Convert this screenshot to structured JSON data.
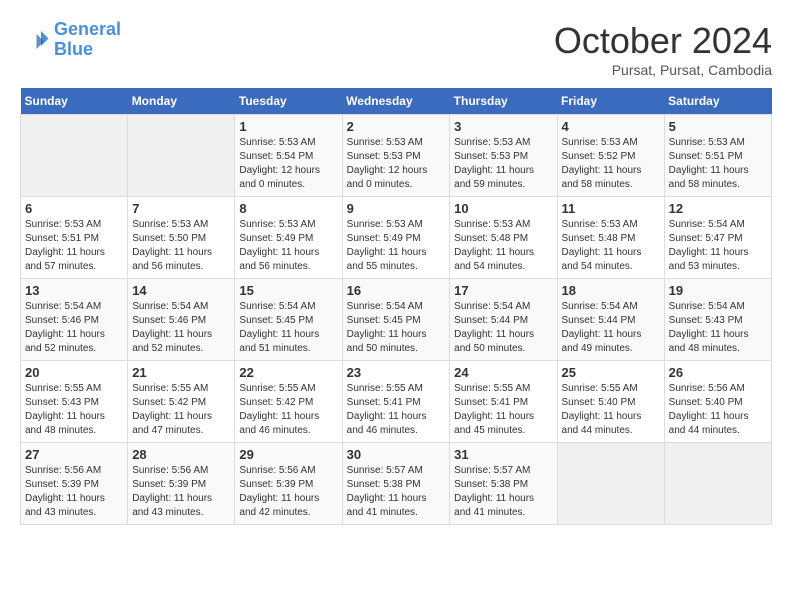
{
  "logo": {
    "line1": "General",
    "line2": "Blue"
  },
  "title": "October 2024",
  "subtitle": "Pursat, Pursat, Cambodia",
  "days_of_week": [
    "Sunday",
    "Monday",
    "Tuesday",
    "Wednesday",
    "Thursday",
    "Friday",
    "Saturday"
  ],
  "weeks": [
    [
      {
        "day": "",
        "info": ""
      },
      {
        "day": "",
        "info": ""
      },
      {
        "day": "1",
        "info": "Sunrise: 5:53 AM\nSunset: 5:54 PM\nDaylight: 12 hours and 0 minutes."
      },
      {
        "day": "2",
        "info": "Sunrise: 5:53 AM\nSunset: 5:53 PM\nDaylight: 12 hours and 0 minutes."
      },
      {
        "day": "3",
        "info": "Sunrise: 5:53 AM\nSunset: 5:53 PM\nDaylight: 11 hours and 59 minutes."
      },
      {
        "day": "4",
        "info": "Sunrise: 5:53 AM\nSunset: 5:52 PM\nDaylight: 11 hours and 58 minutes."
      },
      {
        "day": "5",
        "info": "Sunrise: 5:53 AM\nSunset: 5:51 PM\nDaylight: 11 hours and 58 minutes."
      }
    ],
    [
      {
        "day": "6",
        "info": "Sunrise: 5:53 AM\nSunset: 5:51 PM\nDaylight: 11 hours and 57 minutes."
      },
      {
        "day": "7",
        "info": "Sunrise: 5:53 AM\nSunset: 5:50 PM\nDaylight: 11 hours and 56 minutes."
      },
      {
        "day": "8",
        "info": "Sunrise: 5:53 AM\nSunset: 5:49 PM\nDaylight: 11 hours and 56 minutes."
      },
      {
        "day": "9",
        "info": "Sunrise: 5:53 AM\nSunset: 5:49 PM\nDaylight: 11 hours and 55 minutes."
      },
      {
        "day": "10",
        "info": "Sunrise: 5:53 AM\nSunset: 5:48 PM\nDaylight: 11 hours and 54 minutes."
      },
      {
        "day": "11",
        "info": "Sunrise: 5:53 AM\nSunset: 5:48 PM\nDaylight: 11 hours and 54 minutes."
      },
      {
        "day": "12",
        "info": "Sunrise: 5:54 AM\nSunset: 5:47 PM\nDaylight: 11 hours and 53 minutes."
      }
    ],
    [
      {
        "day": "13",
        "info": "Sunrise: 5:54 AM\nSunset: 5:46 PM\nDaylight: 11 hours and 52 minutes."
      },
      {
        "day": "14",
        "info": "Sunrise: 5:54 AM\nSunset: 5:46 PM\nDaylight: 11 hours and 52 minutes."
      },
      {
        "day": "15",
        "info": "Sunrise: 5:54 AM\nSunset: 5:45 PM\nDaylight: 11 hours and 51 minutes."
      },
      {
        "day": "16",
        "info": "Sunrise: 5:54 AM\nSunset: 5:45 PM\nDaylight: 11 hours and 50 minutes."
      },
      {
        "day": "17",
        "info": "Sunrise: 5:54 AM\nSunset: 5:44 PM\nDaylight: 11 hours and 50 minutes."
      },
      {
        "day": "18",
        "info": "Sunrise: 5:54 AM\nSunset: 5:44 PM\nDaylight: 11 hours and 49 minutes."
      },
      {
        "day": "19",
        "info": "Sunrise: 5:54 AM\nSunset: 5:43 PM\nDaylight: 11 hours and 48 minutes."
      }
    ],
    [
      {
        "day": "20",
        "info": "Sunrise: 5:55 AM\nSunset: 5:43 PM\nDaylight: 11 hours and 48 minutes."
      },
      {
        "day": "21",
        "info": "Sunrise: 5:55 AM\nSunset: 5:42 PM\nDaylight: 11 hours and 47 minutes."
      },
      {
        "day": "22",
        "info": "Sunrise: 5:55 AM\nSunset: 5:42 PM\nDaylight: 11 hours and 46 minutes."
      },
      {
        "day": "23",
        "info": "Sunrise: 5:55 AM\nSunset: 5:41 PM\nDaylight: 11 hours and 46 minutes."
      },
      {
        "day": "24",
        "info": "Sunrise: 5:55 AM\nSunset: 5:41 PM\nDaylight: 11 hours and 45 minutes."
      },
      {
        "day": "25",
        "info": "Sunrise: 5:55 AM\nSunset: 5:40 PM\nDaylight: 11 hours and 44 minutes."
      },
      {
        "day": "26",
        "info": "Sunrise: 5:56 AM\nSunset: 5:40 PM\nDaylight: 11 hours and 44 minutes."
      }
    ],
    [
      {
        "day": "27",
        "info": "Sunrise: 5:56 AM\nSunset: 5:39 PM\nDaylight: 11 hours and 43 minutes."
      },
      {
        "day": "28",
        "info": "Sunrise: 5:56 AM\nSunset: 5:39 PM\nDaylight: 11 hours and 43 minutes."
      },
      {
        "day": "29",
        "info": "Sunrise: 5:56 AM\nSunset: 5:39 PM\nDaylight: 11 hours and 42 minutes."
      },
      {
        "day": "30",
        "info": "Sunrise: 5:57 AM\nSunset: 5:38 PM\nDaylight: 11 hours and 41 minutes."
      },
      {
        "day": "31",
        "info": "Sunrise: 5:57 AM\nSunset: 5:38 PM\nDaylight: 11 hours and 41 minutes."
      },
      {
        "day": "",
        "info": ""
      },
      {
        "day": "",
        "info": ""
      }
    ]
  ]
}
